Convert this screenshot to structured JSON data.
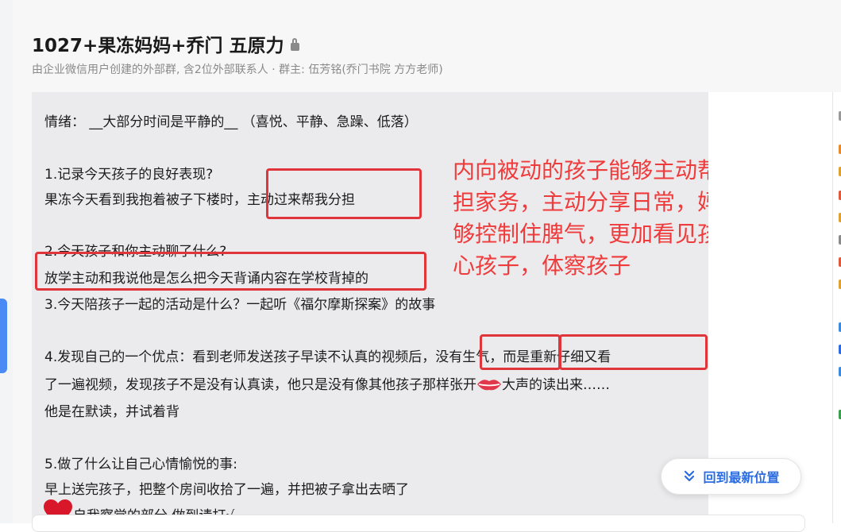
{
  "header": {
    "title": "1027+果冻妈妈+乔门 五原力",
    "subtitle": "由企业微信用户创建的外部群, 含2位外部联系人 · 群主: 伍芳铭(乔门书院 方方老师)"
  },
  "message": {
    "lines": [
      "情绪：  __大部分时间是平静的__  （喜悦、平静、急躁、低落）",
      "1.记录今天孩子的良好表现?",
      "果冻今天看到我抱着被子下楼时，主动过来帮我分担",
      "2.今天孩子和你主动聊了什么?",
      "放学主动和我说他是怎么把今天背诵内容在学校背掉的",
      "3.今天陪孩子一起的活动是什么？一起听《福尔摩斯探案》的故事",
      "4.发现自己的一个优点：看到老师发送孩子早读不认真的视频后，没有生气，而是重新仔细又看",
      "了一遍视频，发现孩子不是没有认真读，他只是没有像其他孩子那样张开",
      "大声的读出来……",
      "他是在默读，并试着背",
      "5.做了什么让自己心情愉悦的事:",
      "早上送完孩子，把整个房间收拾了一遍，并把被子拿出去晒了",
      "自我察觉的部分 做到请打√"
    ]
  },
  "annotation": {
    "note": "内向被动的孩子能够主动帮妈妈分担家务，主动分享日常，妈妈也能够控制住脾气，更加看见孩子，关心孩子，体察孩子",
    "color": "#ef3b3b"
  },
  "floating_button": {
    "label": "回到最新位置",
    "icon": "double-chevron-down-icon"
  },
  "colors": {
    "accent": "#2b6de0",
    "highlight_box": "#e0353a"
  }
}
